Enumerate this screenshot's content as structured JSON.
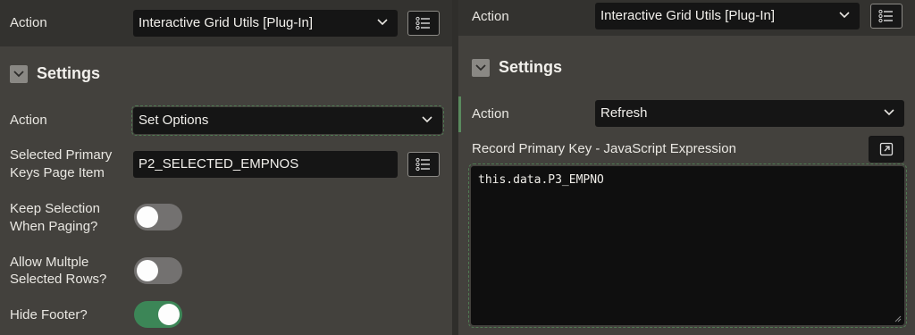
{
  "left": {
    "header": {
      "action_label": "Action",
      "action_value": "Interactive Grid Utils [Plug-In]"
    },
    "settings_title": "Settings",
    "fields": {
      "action_label": "Action",
      "action_value": "Set Options",
      "selected_pk_label_line1": "Selected Primary",
      "selected_pk_label_line2": "Keys Page Item",
      "selected_pk_value": "P2_SELECTED_EMPNOS",
      "keep_sel_label_line1": "Keep Selection",
      "keep_sel_label_line2": "When Paging?",
      "allow_multi_label_line1": "Allow Multple",
      "allow_multi_label_line2": "Selected Rows?",
      "hide_footer_label": "Hide Footer?"
    },
    "toggles": {
      "keep_selection": false,
      "allow_multiple": false,
      "hide_footer": true
    }
  },
  "right": {
    "header": {
      "action_label": "Action",
      "action_value": "Interactive Grid Utils [Plug-In]"
    },
    "settings_title": "Settings",
    "fields": {
      "action_label": "Action",
      "action_value": "Refresh",
      "record_pk_label": "Record Primary Key - JavaScript Expression",
      "code_value": "this.data.P3_EMPNO"
    }
  },
  "icons": {
    "list": "list-icon",
    "chevron": "chevron-down-icon",
    "expand": "expand-icon",
    "collapse": "collapse-chevron-icon"
  }
}
